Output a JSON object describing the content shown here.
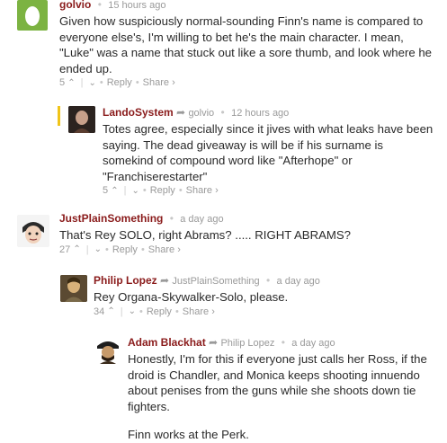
{
  "comments": [
    {
      "author": "golvio",
      "reply_to": "",
      "time": "15 hours ago",
      "text": "Given how suspiciously normal-sounding Finn's name is compared to everyone else's, I'm willing to bet he's the main character. I mean, \"Luke\" was a name that stuck out like a sore thumb, and look where he ended up.",
      "votes": "5",
      "reply_label": "Reply",
      "share_label": "Share ›"
    },
    {
      "author": "LandoSystem",
      "reply_to": "golvio",
      "time": "12 hours ago",
      "text": "Totes agree, especially since it jives with what leaks have been saying. The dead giveaway is will be if his surname is somekind of compound word like \"Afterhope\" or \"Franchiserestarter\"",
      "votes": "5",
      "reply_label": "Reply",
      "share_label": "Share ›"
    },
    {
      "author": "JustPlainSomething",
      "reply_to": "",
      "time": "a day ago",
      "text": "That's Rey SOLO, right Abrams? ..... RIGHT ABRAMS?",
      "votes": "27",
      "reply_label": "Reply",
      "share_label": "Share ›"
    },
    {
      "author": "Philip Lopez",
      "reply_to": "JustPlainSomething",
      "time": "a day ago",
      "text": "Rey Organa-Skywalker-Solo, please.",
      "votes": "34",
      "reply_label": "Reply",
      "share_label": "Share ›"
    },
    {
      "author": "Adam Blackhat",
      "reply_to": "Philip Lopez",
      "time": "a day ago",
      "text": "Honestly, I'm for this if everyone just calls her Ross, if the droid is Chandler, and Monica keeps shooting innuendo about penises from the guns while she shoots down tie fighters.",
      "text2": "Finn works at the Perk."
    }
  ],
  "icons": {
    "upvote": "chevron-up-icon",
    "downvote": "chevron-down-icon",
    "reply_arrow": "reply-arrow-icon"
  },
  "colors": {
    "author": "#8a1b1b",
    "meta": "#9a9a9a",
    "golvio_avatar_bg": "#7cb342",
    "highlight": "#f0c419"
  }
}
